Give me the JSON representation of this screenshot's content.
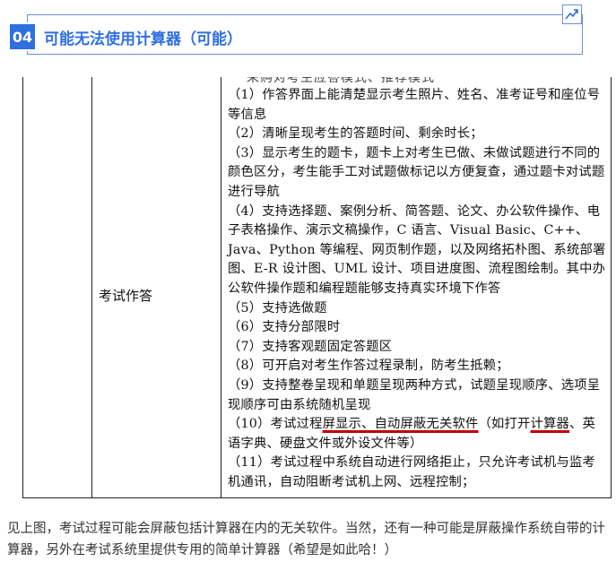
{
  "header": {
    "number": "04",
    "title": "可能无法使用计算器（可能）"
  },
  "document": {
    "cut_top_text": "采购对考生应答模式、推荐模式",
    "left_label": "考试作答",
    "items": [
      "（1）作答界面上能清楚显示考生照片、姓名、准考证号和座位号等信息",
      "（2）清晰呈现考生的答题时间、剩余时长；",
      "（3）显示考生的题卡，题卡上对考生已做、未做试题进行不同的颜色区分，考生能手工对试题做标记以方便复查，通过题卡对试题进行导航",
      "（4）支持选择题、案例分析、简答题、论文、办公软件操作、电子表格操作、演示文稿操作，C 语言、Visual Basic、C++、Java、Python 等编程、网页制作题，以及网络拓朴图、系统部署图、E-R 设计图、UML 设计、项目进度图、流程图绘制。其中办公软件操作题和编程题能够支持真实环境下作答",
      "（5）支持选做题",
      "（6）支持分部限时",
      "（7）支持客观题固定答题区",
      "（8）可开启对考生作答过程录制，防考生抵赖；",
      "（9）支持整卷呈现和单题呈现两种方式，试题呈现顺序、选项呈现顺序可由系统随机呈现"
    ],
    "item10": {
      "prefix": "（10）考试过程",
      "underlined_1": "屏显示、自动屏蔽无关软件",
      "middle": "（如打开",
      "underlined_2": "计算器",
      "suffix": "、英语字典、硬盘文件或外设文件等）"
    },
    "item11": "（11）考试过程中系统自动进行网络拒止，只允许考试机与监考机通讯，自动阻断考试机上网、远程控制；"
  },
  "caption": "见上图，考试过程可能会屏蔽包括计算器在内的无关软件。当然，还有一种可能是屏蔽操作系统自带的计算器，另外在考试系统里提供专用的简单计算器（希望是如此哈！）",
  "colors": {
    "accent": "#2f6fe0",
    "underline": "#c00000"
  }
}
